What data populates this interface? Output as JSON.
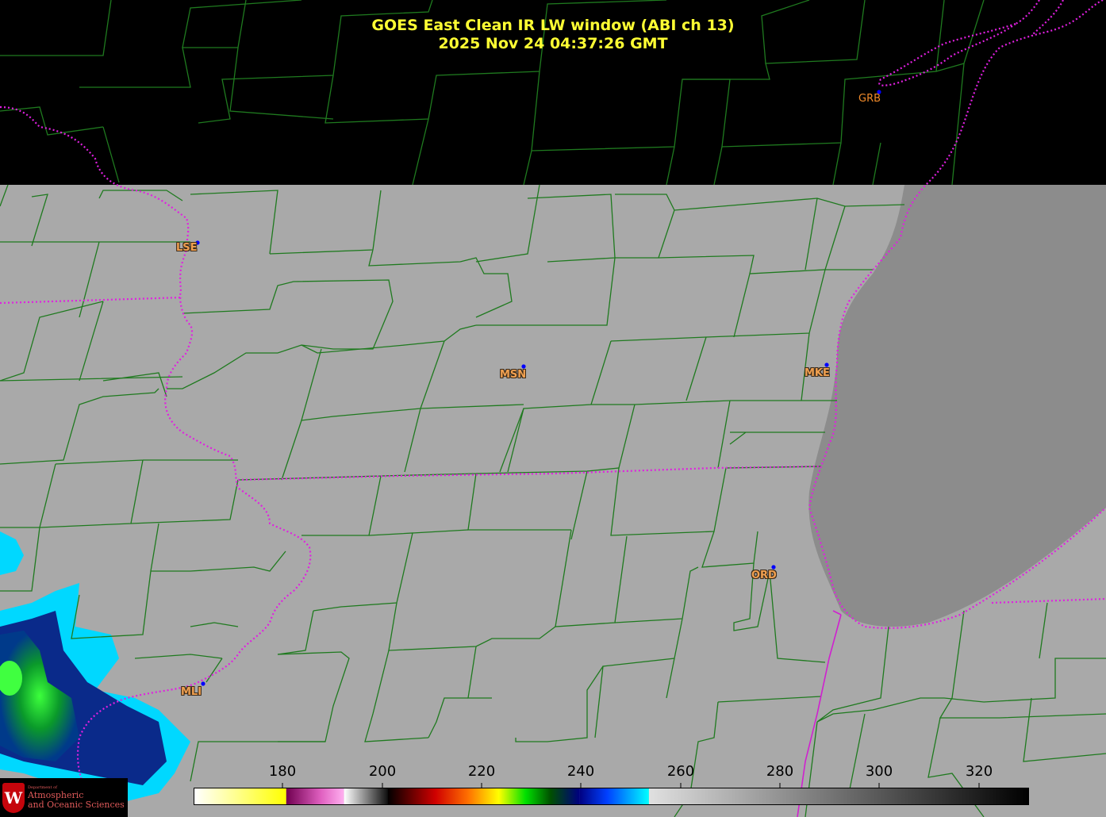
{
  "map": {
    "title_line1": "GOES East Clean IR LW window (ABI ch 13)",
    "title_line2": "2025 Nov 24  04:37:26 GMT",
    "stations": [
      {
        "id": "GRB",
        "label": "GRB"
      },
      {
        "id": "LSE",
        "label": "LSE"
      },
      {
        "id": "MSN",
        "label": "MSN"
      },
      {
        "id": "MKE",
        "label": "MKE"
      },
      {
        "id": "ORD",
        "label": "ORD"
      },
      {
        "id": "MLI",
        "label": "MLI"
      }
    ],
    "colorbar": {
      "ticks": [
        "180",
        "200",
        "220",
        "240",
        "260",
        "280",
        "300",
        "320"
      ]
    },
    "logo": {
      "department_of": "Department of",
      "line1": "Atmospheric",
      "line2": "and Oceanic Sciences",
      "crest_letter": "W"
    },
    "colors": {
      "title": "#ffff33",
      "county_lines": "#1f7a1f",
      "state_lines": "#e020e0",
      "station_dot": "#0000ff",
      "station_label": "#f0a050",
      "land_gray": "#a9a9a9",
      "lake_gray": "#8c8c8c"
    }
  }
}
